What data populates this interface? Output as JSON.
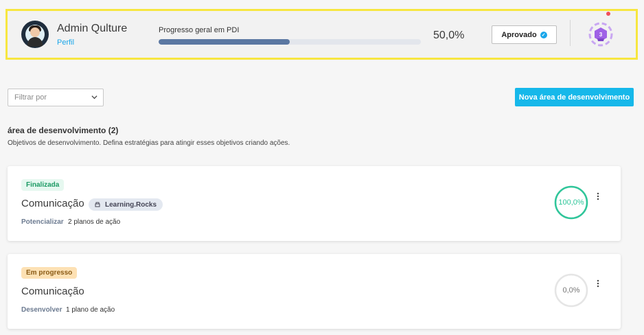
{
  "header": {
    "user_name": "Admin Qulture",
    "profile_link": "Perfil",
    "progress_label": "Progresso geral em PDI",
    "progress_percent": 50,
    "progress_value": "50,0%",
    "approved_label": "Aprovado",
    "level_badge": "3"
  },
  "toolbar": {
    "filter_placeholder": "Filtrar por",
    "new_area_label": "Nova área de desenvolvimento"
  },
  "section": {
    "title": "área de desenvolvimento (2)",
    "description": "Objetivos de desenvolvimento. Defina estratégias para atingir esses objetivos criando ações."
  },
  "cards": [
    {
      "status": "Finalizada",
      "title": "Comunicação",
      "tag": "Learning.Rocks",
      "category": "Potencializar",
      "plans": "2 planos de ação",
      "progress_percent": 100,
      "progress_label": "100,0%"
    },
    {
      "status": "Em progresso",
      "title": "Comunicação",
      "category": "Desenvolver",
      "plans": "1 plano de ação",
      "progress_percent": 0,
      "progress_label": "0,0%"
    }
  ],
  "colors": {
    "accent": "#16b8ea",
    "progress_fill": "#5b78a2",
    "ring_done": "#2fc69a",
    "ring_empty": "#e5e5e5",
    "highlight": "#f7e640"
  }
}
